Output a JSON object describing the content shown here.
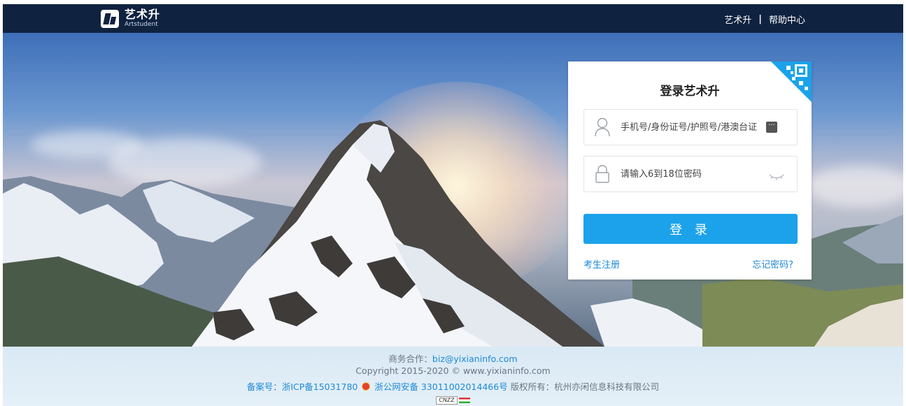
{
  "header": {
    "brand_cn": "艺术升",
    "brand_en": "Artstudent",
    "links": [
      "艺术升",
      "帮助中心"
    ],
    "separator": "|"
  },
  "login": {
    "title": "登录艺术升",
    "username_placeholder": "手机号/身份证号/护照号/港澳台证",
    "password_placeholder": "请输入6到18位密码",
    "submit_label": "登 录",
    "register_link": "考生注册",
    "forgot_link": "忘记密码?"
  },
  "footer": {
    "contact_label": "商务合作：",
    "contact_email": "biz@yixianinfo.com",
    "copyright": "Copyright  2015-2020 © www.yixianinfo.com",
    "icp_label": "备案号：",
    "icp_value": "浙ICP备15031780",
    "police_value": "浙公网安备 33011002014466号",
    "rights": "版权所有：杭州亦闲信息科技有限公司",
    "stat_badge": "CNZZ"
  },
  "colors": {
    "header_bg": "#0f2240",
    "accent": "#1ca2ea",
    "link": "#1e89d6"
  },
  "icons": [
    "logo-mark",
    "qr-code-icon",
    "user-icon",
    "more-icon",
    "lock-icon",
    "eye-closed-icon",
    "police-badge-icon",
    "cnzz-flag-icon"
  ]
}
